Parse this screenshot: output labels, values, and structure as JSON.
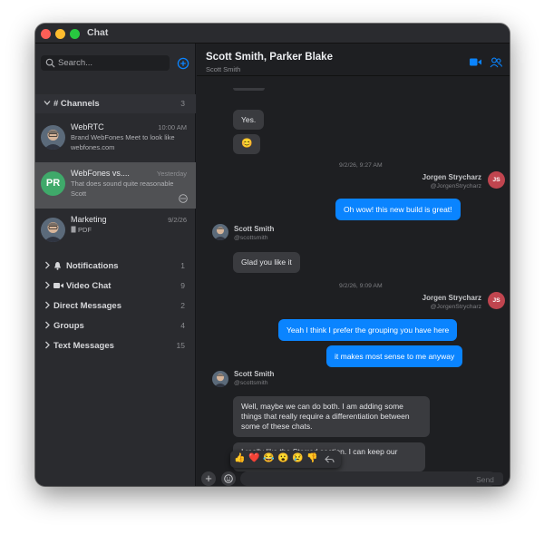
{
  "window": {
    "title": "Chat"
  },
  "sidebar": {
    "search_placeholder": "Search...",
    "channels": {
      "label": "# Channels",
      "count": "3"
    },
    "conversations": [
      {
        "name": "WebRTC",
        "time": "10:00 AM",
        "preview": "Brand WebFones Meet to look like webfones.com"
      },
      {
        "name": "WebFones vs....",
        "time": "Yesterday",
        "preview": "That does sound quite reasonable Scott",
        "initials": "PR"
      },
      {
        "name": "Marketing",
        "time": "9/2/26",
        "preview": "PDF"
      }
    ],
    "sections": [
      {
        "label": "Notifications",
        "count": "1",
        "icon": "bell-icon"
      },
      {
        "label": "Video Chat",
        "count": "9",
        "icon": "video-camera-icon"
      },
      {
        "label": "Direct Messages",
        "count": "2"
      },
      {
        "label": "Groups",
        "count": "4"
      },
      {
        "label": "Text Messages",
        "count": "15"
      }
    ]
  },
  "chat": {
    "title": "Scott Smith, Parker Blake",
    "subtitle": "Scott Smith",
    "messages": {
      "yes": "Yes.",
      "smile": "😊",
      "ts1": "9/2/26, 9:27 AM",
      "jorgen_name": "Jorgen Strycharz",
      "jorgen_handle": "@JorgenStrycharz",
      "jorgen_initials": "JS",
      "m_oh_wow": "Oh wow! this new build is great!",
      "scott_name": "Scott Smith",
      "scott_handle": "@scottsmith",
      "m_glad": "Glad you like it",
      "ts2": "9/2/26, 9:09 AM",
      "m_yeah": "Yeah I think I prefer the grouping you have here",
      "m_sense": "it makes most sense to me anyway",
      "m_maybe": "Well, maybe we can do both.  I am adding some things that really require a differentiation between some of these chats.",
      "m_starred": "I really like the Starred section.  I can keep our chats right up at the top"
    },
    "reactions": [
      "👍",
      "❤️",
      "😂",
      "😮",
      "😢",
      "👎"
    ],
    "composer": {
      "send_label": "Send",
      "plus_label": "+"
    }
  },
  "colors": {
    "accent": "#0a84ff",
    "background": "#1f2024",
    "initials_avatar": "#c0454f",
    "pr_avatar": "#3fa96a"
  }
}
